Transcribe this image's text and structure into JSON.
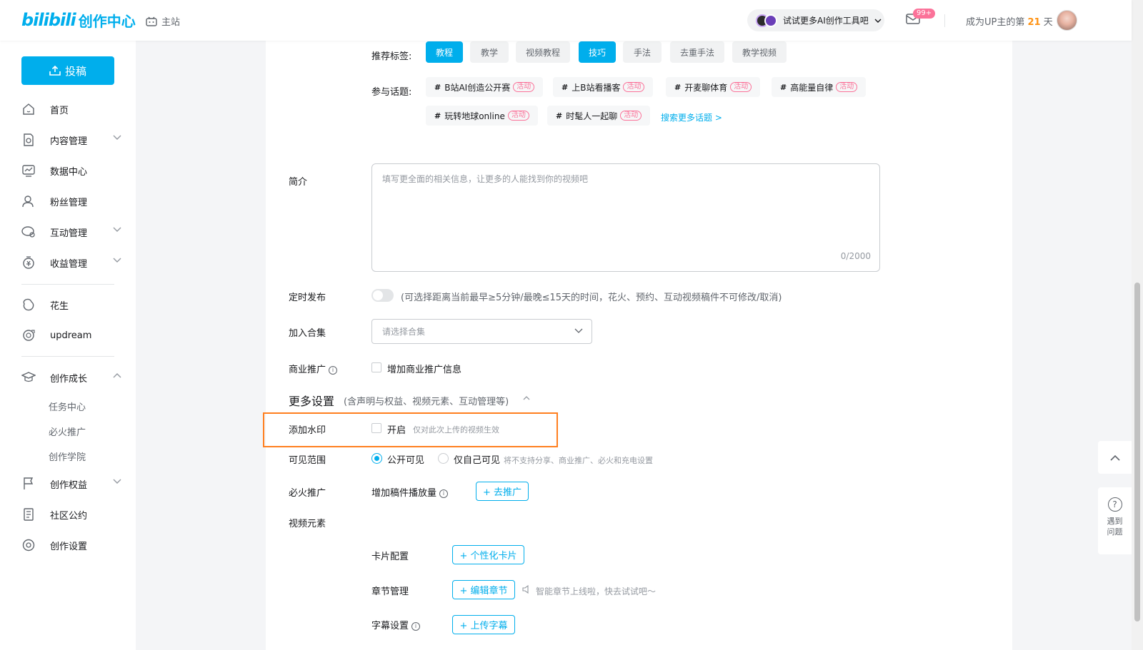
{
  "header": {
    "logo_bili": "bilibili",
    "logo_suffix": "创作中心",
    "main_site": "主站",
    "ai_pill": "试试更多AI创作工具吧",
    "mail_badge": "99+",
    "up_prefix": "成为UP主的第",
    "up_days": "21",
    "up_suffix": "天"
  },
  "sidebar": {
    "upload": "投稿",
    "items": [
      {
        "label": "首页",
        "icon": "home-icon"
      },
      {
        "label": "内容管理",
        "icon": "content-icon"
      },
      {
        "label": "数据中心",
        "icon": "chart-icon"
      },
      {
        "label": "粉丝管理",
        "icon": "fans-icon"
      },
      {
        "label": "互动管理",
        "icon": "interact-icon"
      },
      {
        "label": "收益管理",
        "icon": "money-icon"
      },
      {
        "label": "花生",
        "icon": "peanut-icon"
      },
      {
        "label": "updream",
        "icon": "updream-icon"
      },
      {
        "label": "创作成长",
        "icon": "growth-icon"
      },
      {
        "label": "创作权益",
        "icon": "flag-icon"
      },
      {
        "label": "社区公约",
        "icon": "rules-icon"
      },
      {
        "label": "创作设置",
        "icon": "settings-icon"
      }
    ],
    "sub_items": [
      "任务中心",
      "必火推广",
      "创作学院"
    ]
  },
  "form": {
    "tags_label": "推荐标签:",
    "tags": [
      {
        "label": "教程",
        "active": true
      },
      {
        "label": "教学",
        "active": false
      },
      {
        "label": "视频教程",
        "active": false
      },
      {
        "label": "技巧",
        "active": true
      },
      {
        "label": "手法",
        "active": false
      },
      {
        "label": "去重手法",
        "active": false
      },
      {
        "label": "教学视频",
        "active": false
      }
    ],
    "topics_label": "参与话题:",
    "topic_badge": "活动",
    "topics": [
      "B站AI创造公开赛",
      "上B站看播客",
      "开麦聊体育",
      "高能量自律",
      "玩转地球online",
      "时髦人一起聊"
    ],
    "more_topics": "搜索更多话题 >",
    "intro_label": "简介",
    "intro_placeholder": "填写更全面的相关信息，让更多的人能找到你的视频吧",
    "intro_count": "0/2000",
    "schedule_label": "定时发布",
    "schedule_hint": "(可选择距离当前最早≥5分钟/最晚≤15天的时间，花火、预约、互动视频稿件不可修改/取消)",
    "collection_label": "加入合集",
    "collection_placeholder": "请选择合集",
    "biz_label": "商业推广",
    "biz_checkbox": "增加商业推广信息",
    "more_title": "更多设置",
    "more_sub": "(含声明与权益、视频元素、互动管理等)",
    "watermark_label": "添加水印",
    "watermark_checkbox": "开启",
    "watermark_hint": "仅对此次上传的视频生效",
    "visibility_label": "可见范围",
    "visibility_public": "公开可见",
    "visibility_private": "仅自己可见",
    "visibility_hint": "将不支持分享、商业推广、必火和充电设置",
    "promo_label": "必火推广",
    "promo_text": "增加稿件播放量",
    "promo_button": "+ 去推广",
    "elements_label": "视频元素",
    "card_label": "卡片配置",
    "card_button": "+ 个性化卡片",
    "chapter_label": "章节管理",
    "chapter_button": "+ 编辑章节",
    "chapter_hint": "智能章节上线啦，快去试试吧～",
    "subtitle_label": "字幕设置",
    "subtitle_button": "+ 上传字幕"
  },
  "float": {
    "help": "遇到问题"
  },
  "colors": {
    "accent": "#00aeec",
    "highlight": "#ff7f1f",
    "pink": "#fb7299"
  }
}
